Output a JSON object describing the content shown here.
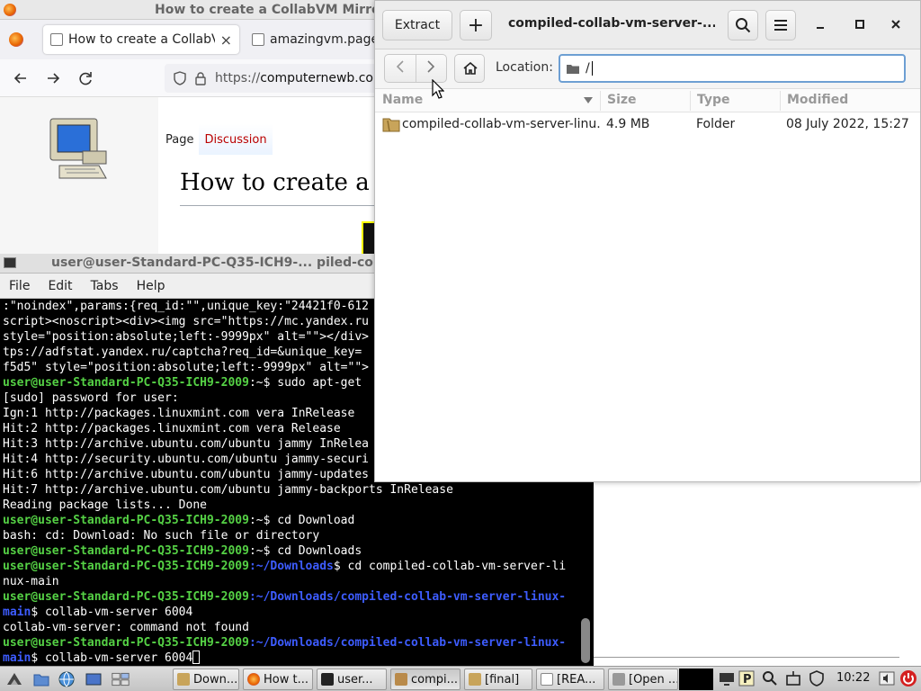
{
  "firefox": {
    "window_title": "How to create a CollabVM Mirro",
    "tabs": [
      {
        "label": "How to create a CollabVM",
        "close": "×"
      },
      {
        "label": "amazingvm.page"
      }
    ],
    "url_prefix": "https://",
    "url_host": "computernewb.co",
    "wiki_tabs": {
      "page": "Page",
      "discussion": "Discussion"
    },
    "heading": "How to create a Co"
  },
  "terminal": {
    "window_title": "user@user-Standard-PC-Q35-ICH9-... piled-colla",
    "menu": [
      "File",
      "Edit",
      "Tabs",
      "Help"
    ],
    "lines": [
      [
        {
          "t": ":\"noindex\",params:{req_id:\"\",unique_key:\"24421f0-612",
          "c": ""
        }
      ],
      [
        {
          "t": "script><noscript><div><img src=\"https://mc.yandex.ru",
          "c": ""
        }
      ],
      [
        {
          "t": "style=\"position:absolute;left:-9999px\" alt=\"\"></div>",
          "c": ""
        }
      ],
      [
        {
          "t": "tps://adfstat.yandex.ru/captcha?req_id=&unique_key=",
          "c": ""
        }
      ],
      [
        {
          "t": "f5d5\" style=\"position:absolute;left:-9999px\" alt=\"\">",
          "c": ""
        }
      ],
      [
        {
          "t": "user@user-Standard-PC-Q35-ICH9-2009",
          "c": "prompt"
        },
        {
          "t": ":~$ sudo apt-get",
          "c": ""
        }
      ],
      [
        {
          "t": "[sudo] password for user:",
          "c": ""
        }
      ],
      [
        {
          "t": "Ign:1 http://packages.linuxmint.com vera InRelease",
          "c": ""
        }
      ],
      [
        {
          "t": "Hit:2 http://packages.linuxmint.com vera Release",
          "c": ""
        }
      ],
      [
        {
          "t": "Hit:3 http://archive.ubuntu.com/ubuntu jammy InRelea",
          "c": ""
        }
      ],
      [
        {
          "t": "Hit:4 http://security.ubuntu.com/ubuntu jammy-securi",
          "c": ""
        }
      ],
      [
        {
          "t": "Hit:6 http://archive.ubuntu.com/ubuntu jammy-updates",
          "c": ""
        }
      ],
      [
        {
          "t": "Hit:7 http://archive.ubuntu.com/ubuntu jammy-backports InRelease",
          "c": ""
        }
      ],
      [
        {
          "t": "Reading package lists... Done",
          "c": ""
        }
      ],
      [
        {
          "t": "user@user-Standard-PC-Q35-ICH9-2009",
          "c": "prompt"
        },
        {
          "t": ":~$ cd Download",
          "c": ""
        }
      ],
      [
        {
          "t": "bash: cd: Download: No such file or directory",
          "c": ""
        }
      ],
      [
        {
          "t": "user@user-Standard-PC-Q35-ICH9-2009",
          "c": "prompt"
        },
        {
          "t": ":~$ cd Downloads",
          "c": ""
        }
      ],
      [
        {
          "t": "user@user-Standard-PC-Q35-ICH9-2009",
          "c": "prompt"
        },
        {
          "t": ":~/Downloads",
          "c": "path"
        },
        {
          "t": "$ cd compiled-collab-vm-server-li",
          "c": ""
        }
      ],
      [
        {
          "t": "nux-main",
          "c": ""
        }
      ],
      [
        {
          "t": "user@user-Standard-PC-Q35-ICH9-2009",
          "c": "prompt"
        },
        {
          "t": ":~/Downloads/compiled-collab-vm-server-linux-",
          "c": "path"
        }
      ],
      [
        {
          "t": "main",
          "c": "path"
        },
        {
          "t": "$ collab-vm-server 6004",
          "c": ""
        }
      ],
      [
        {
          "t": "collab-vm-server: command not found",
          "c": ""
        }
      ],
      [
        {
          "t": "user@user-Standard-PC-Q35-ICH9-2009",
          "c": "prompt"
        },
        {
          "t": ":~/Downloads/compiled-collab-vm-server-linux-",
          "c": "path"
        }
      ],
      [
        {
          "t": "main",
          "c": "path"
        },
        {
          "t": "$ collab-vm-server 6004",
          "c": ""
        }
      ]
    ]
  },
  "archive": {
    "extract_label": "Extract",
    "add_label": "+",
    "title": "compiled-collab-vm-server-...",
    "location_label": "Location:",
    "location_value": "/",
    "columns": {
      "name": "Name",
      "size": "Size",
      "type": "Type",
      "modified": "Modified"
    },
    "rows": [
      {
        "name": "compiled-collab-vm-server-linu...",
        "size": "4.9 MB",
        "type": "Folder",
        "modified": "08 July 2022, 15:27"
      }
    ]
  },
  "taskbar": {
    "tasks": [
      "Down...",
      "How t...",
      "user...",
      "compi...",
      "[final]",
      "[REA...",
      "[Open ..."
    ],
    "clock": "10:22"
  },
  "colors": {
    "prompt_green": "#55d145",
    "path_blue": "#3d5cff",
    "focus_blue": "#6d9fd3",
    "wiki_link_red": "#ba0000"
  }
}
